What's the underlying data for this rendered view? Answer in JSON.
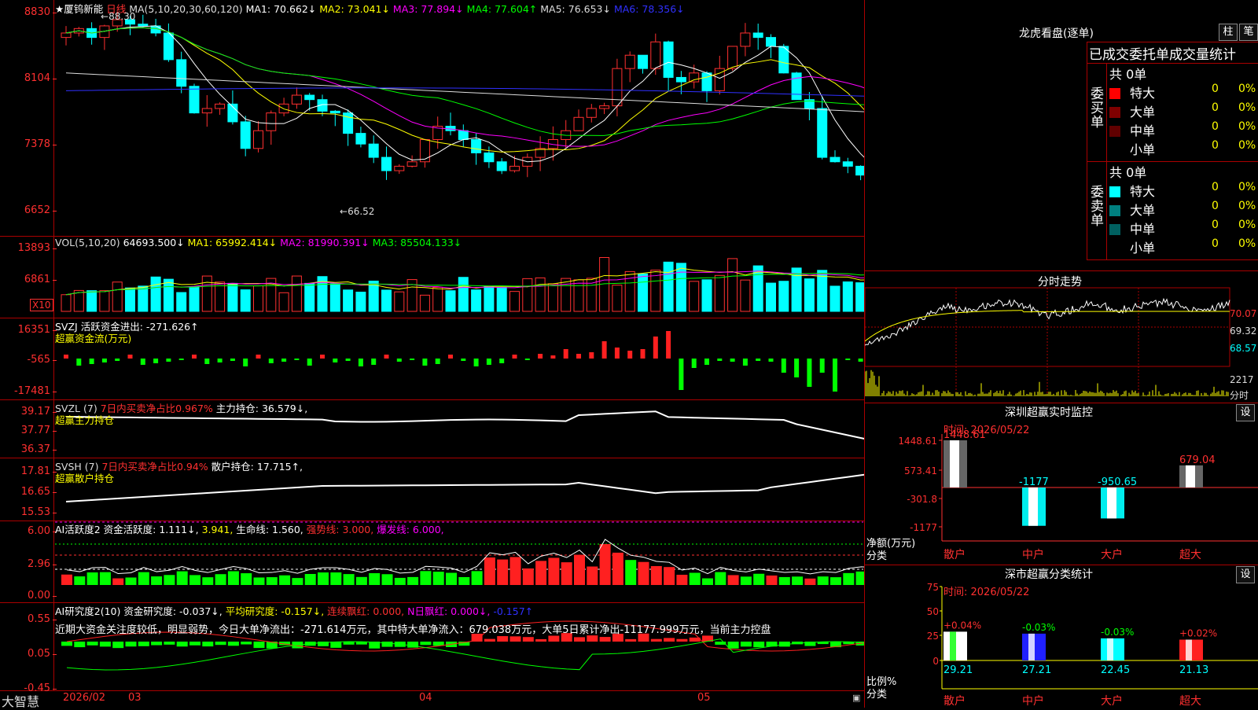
{
  "main_chart": {
    "stock_name": "★厦钨新能",
    "period": "日线",
    "ma_label": "MA(5,10,20,30,60,120)",
    "ma_items": [
      {
        "label": "MA1: 70.662↓",
        "color": "#ffffff"
      },
      {
        "label": "MA2: 73.041↓",
        "color": "#ffff00"
      },
      {
        "label": "MA3: 77.894↓",
        "color": "#ff00ff"
      },
      {
        "label": "MA4: 77.604↑",
        "color": "#00ff00"
      },
      {
        "label": "MA5: 76.653↓",
        "color": "#dddddd"
      },
      {
        "label": "MA6: 78.356↓",
        "color": "#3030ff"
      }
    ],
    "price_ticks": [
      "8830",
      "8104",
      "7378",
      "6652"
    ],
    "high_label": "88.30",
    "low_label": "66.52",
    "prices": [
      86,
      86.5,
      85.5,
      86.8,
      87.5,
      87,
      86.8,
      86,
      83,
      80,
      77,
      77.5,
      78,
      76,
      73,
      75,
      77,
      78,
      79,
      78.5,
      77.2,
      77,
      74.7,
      73.5,
      72,
      70.5,
      71,
      71.5,
      74,
      75.5,
      75,
      74,
      72.5,
      71.5,
      70.5,
      71,
      72,
      73,
      74,
      75,
      76.5,
      77.5,
      77.8,
      82,
      83.5,
      82,
      85,
      81,
      80.5,
      81.5,
      79.5,
      82,
      84.5,
      86,
      85.5,
      84.5,
      81.5,
      78.5,
      77.5,
      72,
      71.5,
      71,
      70,
      70.5
    ]
  },
  "vol_panel": {
    "label": "VOL(5,10,20)",
    "value": "64693.500↓",
    "items": [
      {
        "label": "MA1: 65992.414↓",
        "color": "#ffff00"
      },
      {
        "label": "MA2: 81990.391↓",
        "color": "#ff00ff"
      },
      {
        "label": "MA3: 85504.133↓",
        "color": "#00ff00"
      }
    ],
    "ticks": [
      "13893",
      "6861"
    ],
    "unit_box": "X10"
  },
  "svzj_panel": {
    "label": "SVZJ  活跃资金进出: -271.626↑",
    "sub": "超赢资金流(万元)",
    "ticks": [
      "16351",
      "-565",
      "-17481"
    ]
  },
  "svzl_panel": {
    "label": "SVZL (7)",
    "highlight": "7日内买卖净占比0.967%",
    "rest": "主力持仓: 36.579↓,",
    "sub": "超赢主力持仓",
    "ticks": [
      "39.17",
      "37.77",
      "36.37"
    ]
  },
  "svsh_panel": {
    "label": "SVSH (7)",
    "highlight": "7日内买卖净占比0.94%",
    "rest": "散户持仓: 17.715↑,",
    "sub": "超赢散户持仓",
    "ticks": [
      "17.81",
      "16.65",
      "15.53"
    ]
  },
  "ai_active_panel": {
    "label": "AI活跃度2 资金活跃度: 1.111↓,",
    "v2": "3.941,",
    "v3": "生命线: 1.560,",
    "strong": "强势线: 3.000,",
    "burst": "爆发线: 6.000,",
    "ticks": [
      "6.00",
      "2.96",
      "0.00"
    ]
  },
  "ai_research_panel": {
    "label": "AI研究度2(10) 资金研究度: -0.037↓,",
    "avg": "平均研究度: -0.157↓,",
    "red": "连续飘红: 0.000,",
    "nred": "N日飘红: 0.000↓,",
    "last": "-0.157↑",
    "comment": "近期大资金关注度较低，明显弱势，今日大单净流出：-271.614万元，其中特大单净流入：679.038万元，大单5日累计净出-11177.999万元，当前主力控盘",
    "ticks": [
      "0.55",
      "0.05",
      "-0.45"
    ]
  },
  "bottom_bar": {
    "app": "大智慧",
    "dates": [
      "2026/02",
      "03",
      "04",
      "05"
    ]
  },
  "dragon_tiger": {
    "title": "龙虎看盘(逐单)",
    "btn1": "柱",
    "btn2": "笔",
    "tabs": "已成交委托单成交量统计",
    "buy_title": "委买单",
    "sell_title": "委卖单",
    "buy_count": "共 0单",
    "sell_count": "共 0单",
    "buy_rows": [
      {
        "name": "特大",
        "val": "0",
        "pct": "0%",
        "color": "#ff0000"
      },
      {
        "name": "大单",
        "val": "0",
        "pct": "0%",
        "color": "#800000"
      },
      {
        "name": "中单",
        "val": "0",
        "pct": "0%",
        "color": "#600000"
      },
      {
        "name": "小单",
        "val": "0",
        "pct": "0%",
        "color": "#000000"
      }
    ],
    "sell_rows": [
      {
        "name": "特大",
        "val": "0",
        "pct": "0%",
        "color": "#00ffff"
      },
      {
        "name": "大单",
        "val": "0",
        "pct": "0%",
        "color": "#008080"
      },
      {
        "name": "中单",
        "val": "0",
        "pct": "0%",
        "color": "#006060"
      },
      {
        "name": "小单",
        "val": "0",
        "pct": "0%",
        "color": "#000000"
      }
    ]
  },
  "intraday": {
    "title": "分时走势",
    "ticks": [
      "70.07",
      "69.32",
      "68.57"
    ],
    "vol_tick": "2217",
    "vol_label": "分时"
  },
  "monitor": {
    "title": "深圳超赢实时监控",
    "set": "设",
    "time": "时间: 2026/05/22",
    "ticks": [
      "1448.61",
      "573.41",
      "-301.8",
      "-1177"
    ],
    "ylabel": "净额(万元)",
    "xlabel": "分类",
    "bars": [
      {
        "name": "散户",
        "value": 1448.61,
        "label": "1448.61"
      },
      {
        "name": "中户",
        "value": -1177,
        "label": "-1177"
      },
      {
        "name": "大户",
        "value": -950.65,
        "label": "-950.65"
      },
      {
        "name": "超大",
        "value": 679.04,
        "label": "679.04"
      }
    ]
  },
  "classify": {
    "title": "深市超赢分类统计",
    "set": "设",
    "time": "时间: 2026/05/22",
    "ticks": [
      "75",
      "50",
      "25",
      "0"
    ],
    "ylabel": "比例%",
    "xlabel": "分类",
    "bars": [
      {
        "name": "散户",
        "value": 29.21,
        "change": "+0.04%",
        "color": "#ffffff",
        "accent": "#00ff00"
      },
      {
        "name": "中户",
        "value": 27.21,
        "change": "-0.03%",
        "color": "#2020ff",
        "accent": "#ffffff"
      },
      {
        "name": "大户",
        "value": 22.45,
        "change": "-0.03%",
        "color": "#00ffff",
        "accent": "#ffffff"
      },
      {
        "name": "超大",
        "value": 21.13,
        "change": "+0.02%",
        "color": "#ff2020",
        "accent": "#ffffff"
      }
    ]
  }
}
